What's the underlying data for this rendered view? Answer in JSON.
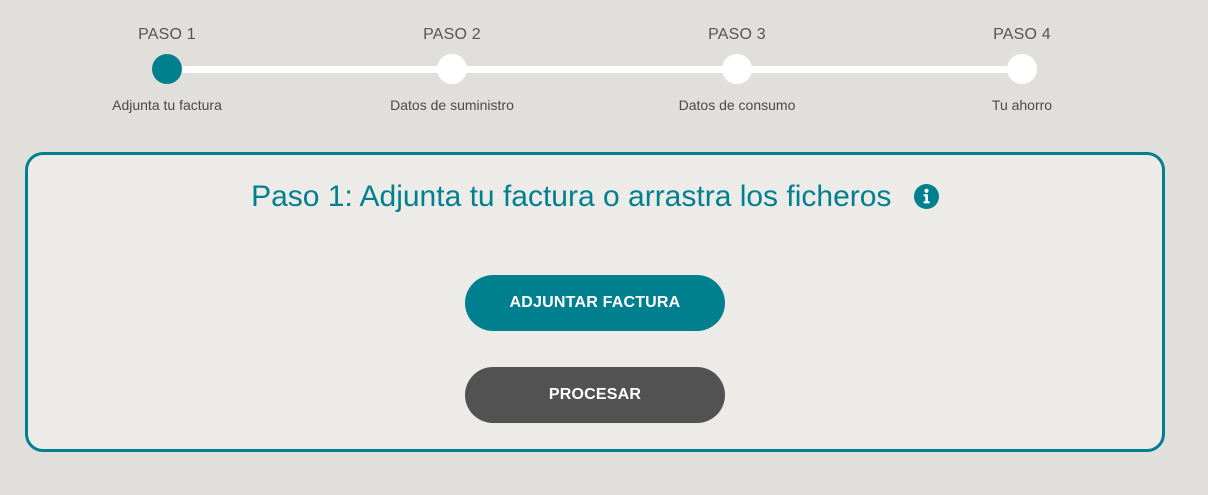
{
  "stepper": {
    "steps": [
      {
        "title": "PASO 1",
        "label": "Adjunta tu factura",
        "active": true
      },
      {
        "title": "PASO 2",
        "label": "Datos de suministro",
        "active": false
      },
      {
        "title": "PASO 3",
        "label": "Datos de consumo",
        "active": false
      },
      {
        "title": "PASO 4",
        "label": "Tu ahorro",
        "active": false
      }
    ]
  },
  "card": {
    "title": "Paso 1: Adjunta tu factura o arrastra los ficheros",
    "info_icon": "info-circle-icon",
    "attach_button_label": "ADJUNTAR FACTURA",
    "process_button_label": "PROCESAR"
  },
  "colors": {
    "accent": "#00808f",
    "background": "#e0dfdb",
    "card_background": "#ecebe8",
    "process_button": "#525252",
    "inactive_step": "#ffffff"
  }
}
